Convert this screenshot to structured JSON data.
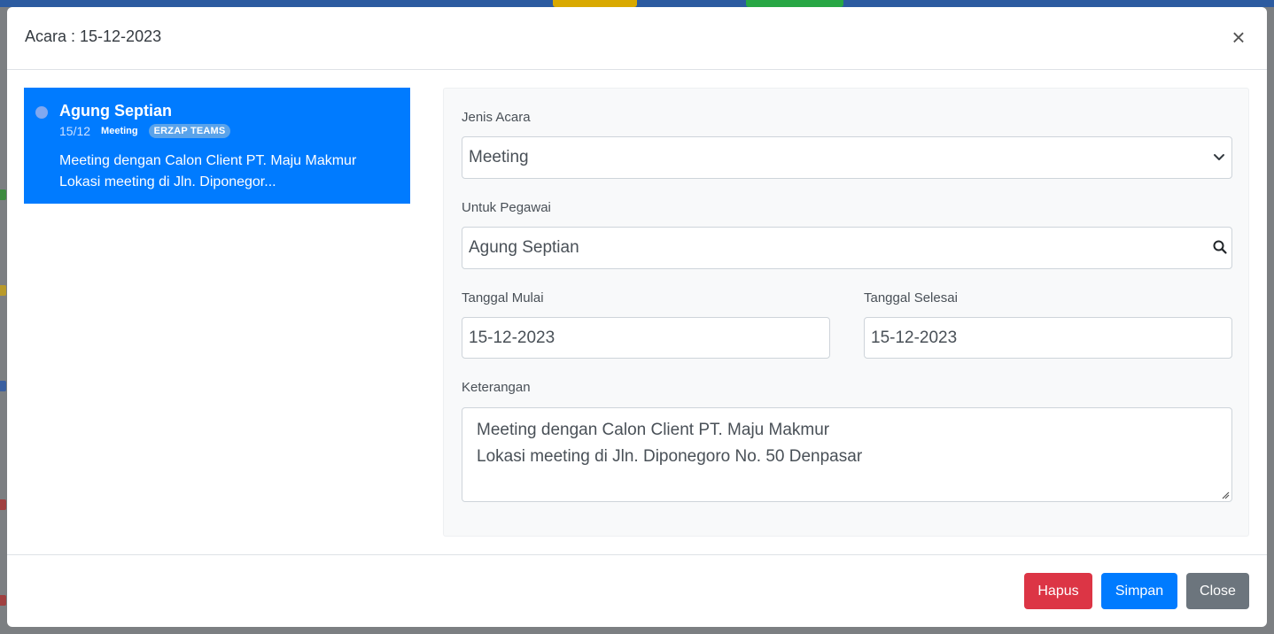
{
  "modal": {
    "title": "Acara : 15-12-2023",
    "close_symbol": "×"
  },
  "event_card": {
    "name": "Agung Septian",
    "date": "15/12",
    "type": "Meeting",
    "badge": "ERZAP TEAMS",
    "description_line1": "Meeting dengan Calon Client PT. Maju Makmur",
    "description_line2": "Lokasi meeting di Jln. Diponegor...",
    "color": "#007bff"
  },
  "form": {
    "jenis_acara_label": "Jenis Acara",
    "jenis_acara_value": "Meeting",
    "untuk_pegawai_label": "Untuk Pegawai",
    "untuk_pegawai_value": "Agung Septian",
    "tanggal_mulai_label": "Tanggal Mulai",
    "tanggal_mulai_value": "15-12-2023",
    "tanggal_selesai_label": "Tanggal Selesai",
    "tanggal_selesai_value": "15-12-2023",
    "keterangan_label": "Keterangan",
    "keterangan_line1": "Meeting dengan Calon Client PT. Maju Makmur",
    "keterangan_line2": "Lokasi meeting di Jln. Diponegoro No. 50 Denpasar"
  },
  "footer": {
    "hapus_label": "Hapus",
    "simpan_label": "Simpan",
    "close_label": "Close"
  },
  "colors": {
    "danger": "#dc3545",
    "primary": "#007bff",
    "secondary": "#6c757d"
  }
}
